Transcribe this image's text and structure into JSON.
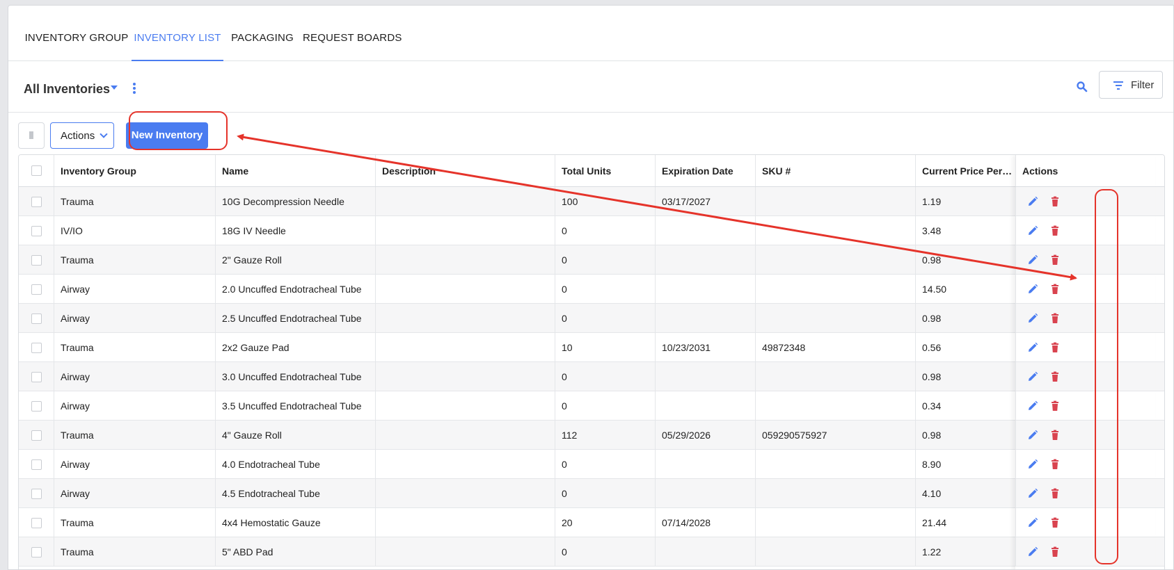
{
  "tabs": [
    {
      "label": "INVENTORY GROUP",
      "active": false
    },
    {
      "label": "INVENTORY LIST",
      "active": true
    },
    {
      "label": "PACKAGING",
      "active": false
    },
    {
      "label": "REQUEST BOARDS",
      "active": false
    }
  ],
  "view": {
    "title": "All Inventories"
  },
  "filter": {
    "label": "Filter"
  },
  "toolbar": {
    "actions_label": "Actions",
    "new_label": "New Inventory"
  },
  "columns": [
    "Inventory Group",
    "Name",
    "Description",
    "Total Units",
    "Expiration Date",
    "SKU #",
    "Current Price Per ...",
    "Actions"
  ],
  "rows": [
    {
      "group": "Trauma",
      "name": "10G Decompression Needle",
      "description": "",
      "units": "100",
      "expiration": "03/17/2027",
      "sku": "",
      "price": "1.19"
    },
    {
      "group": "IV/IO",
      "name": "18G IV Needle",
      "description": "",
      "units": "0",
      "expiration": "",
      "sku": "",
      "price": "3.48"
    },
    {
      "group": "Trauma",
      "name": "2\" Gauze Roll",
      "description": "",
      "units": "0",
      "expiration": "",
      "sku": "",
      "price": "0.98"
    },
    {
      "group": "Airway",
      "name": "2.0 Uncuffed Endotracheal Tube",
      "description": "",
      "units": "0",
      "expiration": "",
      "sku": "",
      "price": "14.50"
    },
    {
      "group": "Airway",
      "name": "2.5 Uncuffed Endotracheal Tube",
      "description": "",
      "units": "0",
      "expiration": "",
      "sku": "",
      "price": "0.98"
    },
    {
      "group": "Trauma",
      "name": "2x2 Gauze Pad",
      "description": "",
      "units": "10",
      "expiration": "10/23/2031",
      "sku": "49872348",
      "price": "0.56"
    },
    {
      "group": "Airway",
      "name": "3.0 Uncuffed Endotracheal Tube",
      "description": "",
      "units": "0",
      "expiration": "",
      "sku": "",
      "price": "0.98"
    },
    {
      "group": "Airway",
      "name": "3.5 Uncuffed Endotracheal Tube",
      "description": "",
      "units": "0",
      "expiration": "",
      "sku": "",
      "price": "0.34"
    },
    {
      "group": "Trauma",
      "name": "4\" Gauze Roll",
      "description": "",
      "units": "112",
      "expiration": "05/29/2026",
      "sku": "059290575927",
      "price": "0.98"
    },
    {
      "group": "Airway",
      "name": "4.0 Endotracheal Tube",
      "description": "",
      "units": "0",
      "expiration": "",
      "sku": "",
      "price": "8.90"
    },
    {
      "group": "Airway",
      "name": "4.5 Endotracheal Tube",
      "description": "",
      "units": "0",
      "expiration": "",
      "sku": "",
      "price": "4.10"
    },
    {
      "group": "Trauma",
      "name": "4x4 Hemostatic Gauze",
      "description": "",
      "units": "20",
      "expiration": "07/14/2028",
      "sku": "",
      "price": "21.44"
    },
    {
      "group": "Trauma",
      "name": "5\" ABD Pad",
      "description": "",
      "units": "0",
      "expiration": "",
      "sku": "",
      "price": "1.22"
    }
  ],
  "colors": {
    "accent": "#4a7cf0",
    "delete": "#d9434f",
    "annotation": "#e5332a"
  },
  "icons": [
    "search-icon",
    "filter-icon",
    "kebab-menu-icon",
    "trash-icon",
    "chevron-down-icon",
    "edit-pencil-icon",
    "delete-trash-icon"
  ]
}
